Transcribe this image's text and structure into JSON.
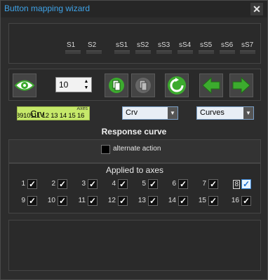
{
  "window": {
    "title": "Button mapping wizard",
    "close_glyph": "✕"
  },
  "slots": [
    "S1",
    "S2",
    "sS1",
    "sS2",
    "sS3",
    "sS4",
    "sS5",
    "sS6",
    "sS7"
  ],
  "toolbar": {
    "spin_value": "10",
    "icons": [
      "eye-icon",
      "paste-icon",
      "copy-icon",
      "reset-icon",
      "arrow-left-icon",
      "arrow-right-icon"
    ]
  },
  "curve": {
    "label_name": "Crv",
    "label_axes_caption": "Axes",
    "label_axes_numbers": "8910111 12 13 14 15 16",
    "combo1_value": "Crv",
    "combo2_value": "Curves",
    "response_title": "Response curve"
  },
  "alternate": {
    "label": "alternate action",
    "checked": false
  },
  "axes": {
    "title": "Applied to axes",
    "items": [
      {
        "n": "1",
        "checked": true
      },
      {
        "n": "2",
        "checked": true
      },
      {
        "n": "3",
        "checked": true
      },
      {
        "n": "4",
        "checked": true
      },
      {
        "n": "5",
        "checked": true
      },
      {
        "n": "6",
        "checked": true
      },
      {
        "n": "7",
        "checked": true
      },
      {
        "n": "8",
        "checked": true,
        "highlight": true
      },
      {
        "n": "9",
        "checked": true
      },
      {
        "n": "10",
        "checked": true
      },
      {
        "n": "11",
        "checked": true
      },
      {
        "n": "12",
        "checked": true
      },
      {
        "n": "13",
        "checked": true
      },
      {
        "n": "14",
        "checked": true
      },
      {
        "n": "15",
        "checked": true
      },
      {
        "n": "16",
        "checked": true
      }
    ]
  },
  "colors": {
    "accent_title": "#3fa3e8",
    "crv_label_bg": "#c6e96a",
    "green_button": "#3cab2e"
  }
}
